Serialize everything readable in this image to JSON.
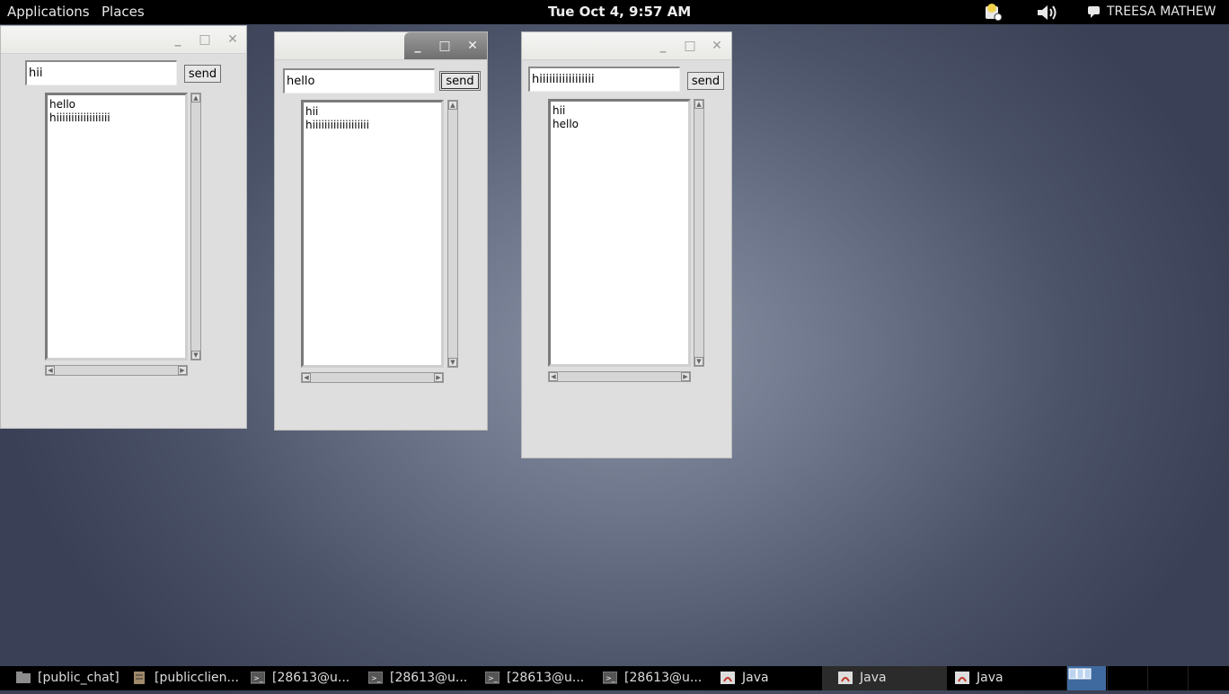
{
  "topbar": {
    "applications": "Applications",
    "places": "Places",
    "clock": "Tue Oct  4,  9:57 AM",
    "user": "TREESA MATHEW"
  },
  "windows": [
    {
      "input": "hii",
      "send": "send",
      "lines": [
        "hello",
        "hiiiiiiiiiiiiiiiiii"
      ]
    },
    {
      "input": "hello",
      "send": "send",
      "lines": [
        "hii",
        "hiiiiiiiiiiiiiiiiiii"
      ]
    },
    {
      "input": "hiiiiiiiiiiiiiiiii",
      "send": "send",
      "lines": [
        "hii",
        "hello"
      ]
    }
  ],
  "taskbar": {
    "items": [
      "[public_chat]",
      "[publicclien...",
      "[28613@u...",
      "[28613@u...",
      "[28613@u...",
      "[28613@u...",
      "Java",
      "Java",
      "Java"
    ]
  }
}
